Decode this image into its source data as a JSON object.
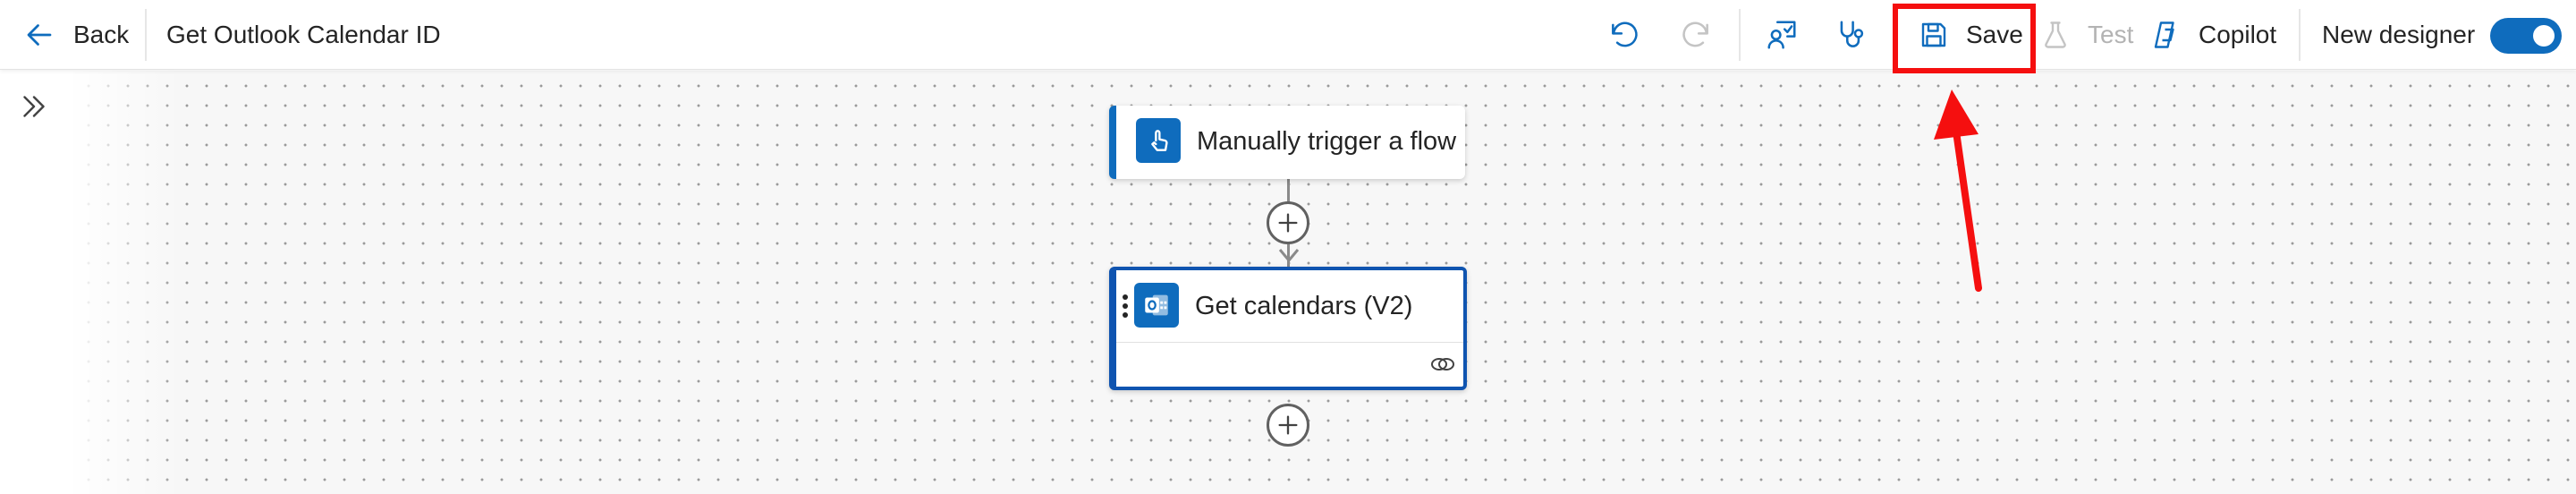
{
  "header": {
    "back_label": "Back",
    "flow_title": "Get Outlook Calendar ID",
    "undo_icon": "undo-icon",
    "redo_icon": "redo-icon",
    "flow_checker_icon": "flow-checker-icon",
    "stethoscope_icon": "stethoscope-icon",
    "save_label": "Save",
    "test_label": "Test",
    "copilot_label": "Copilot",
    "new_designer_label": "New designer",
    "new_designer_enabled": true
  },
  "canvas": {
    "nodes": [
      {
        "title": "Manually trigger a flow",
        "icon": "manual-trigger-icon"
      },
      {
        "title": "Get calendars (V2)",
        "icon": "outlook-icon",
        "footer_icon": "connection-link-icon"
      }
    ]
  },
  "colors": {
    "accent": "#0f6cbd",
    "selected_border": "#0f54b0",
    "annotation_red": "#f50f0f"
  }
}
